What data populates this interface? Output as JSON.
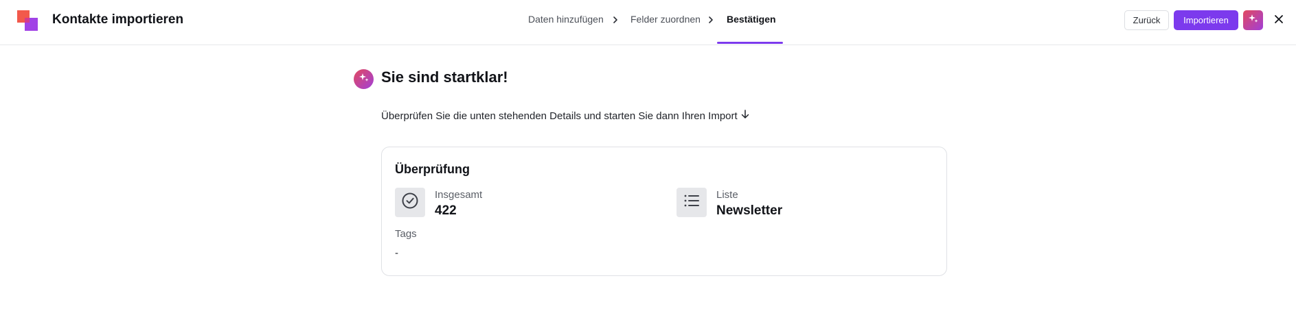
{
  "header": {
    "title": "Kontakte importieren",
    "steps": [
      {
        "label": "Daten hinzufügen",
        "active": false
      },
      {
        "label": "Felder zuordnen",
        "active": false
      },
      {
        "label": "Bestätigen",
        "active": true
      }
    ],
    "back_label": "Zurück",
    "import_label": "Importieren"
  },
  "main": {
    "headline": "Sie sind startklar!",
    "subtext": "Überprüfen Sie die unten stehenden Details und starten Sie dann Ihren Import",
    "review": {
      "title": "Überprüfung",
      "total_label": "Insgesamt",
      "total_value": "422",
      "list_label": "Liste",
      "list_value": "Newsletter",
      "tags_label": "Tags",
      "tags_value": "-"
    }
  },
  "icons": {
    "logo": "brand-logo-icon",
    "step_separator": "chevron-right-icon",
    "ai": "sparkles-icon",
    "close": "close-icon",
    "arrow": "arrow-down-icon",
    "total": "check-circle-icon",
    "list": "list-icon"
  },
  "colors": {
    "accent": "#7c3aed",
    "logo_red": "#f2594b",
    "logo_purple": "#a143e6",
    "ai_gradient_start": "#e2495f",
    "ai_gradient_end": "#a13fd8"
  }
}
